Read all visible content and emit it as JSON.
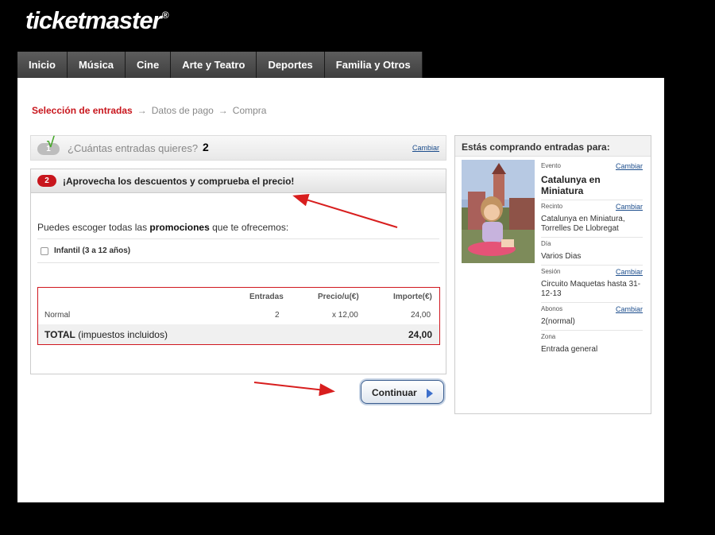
{
  "brand": {
    "logo_text": "ticketmaster",
    "logo_mark": "®"
  },
  "nav": {
    "items": [
      {
        "label": "Inicio"
      },
      {
        "label": "Música"
      },
      {
        "label": "Cine"
      },
      {
        "label": "Arte y Teatro"
      },
      {
        "label": "Deportes"
      },
      {
        "label": "Familia y Otros"
      }
    ]
  },
  "steps": {
    "step1": "Selección de entradas",
    "step2": "Datos de pago",
    "step3": "Compra",
    "arrow": "→"
  },
  "step_one": {
    "badge": "1",
    "check": "√",
    "question": "¿Cuántas entradas quieres?",
    "count": "2",
    "change_label": "Cambiar"
  },
  "step_two": {
    "badge": "2",
    "title": "¡Aprovecha los descuentos y comprueba el precio!",
    "promo_prefix": "Puedes escoger todas las ",
    "promo_bold": "promociones",
    "promo_suffix": " que te ofrecemos:",
    "option_label": "Infantil (3 a 12 años)"
  },
  "price_table": {
    "headers": {
      "entradas": "Entradas",
      "precio": "Precio/u(€)",
      "importe": "Importe(€)"
    },
    "row": {
      "type": "Normal",
      "entradas": "2",
      "precio": "x 12,00",
      "importe": "24,00"
    },
    "total": {
      "label_bold": "TOTAL",
      "label_rest": " (impuestos incluidos)",
      "importe": "24,00"
    }
  },
  "continue_button": {
    "label": "Continuar"
  },
  "sidebar": {
    "title": "Estás comprando entradas para:",
    "change_label": "Cambiar",
    "fields": {
      "evento": {
        "label": "Evento",
        "value": "Catalunya en Miniatura"
      },
      "recinto": {
        "label": "Recinto",
        "value": "Catalunya en Miniatura, Torrelles De Llobregat"
      },
      "dia": {
        "label": "Día",
        "value": "Varios Dias"
      },
      "sesion": {
        "label": "Sesión",
        "value": "Circuito Maquetas hasta 31-12-13"
      },
      "abonos": {
        "label": "Abonos",
        "value": "2(normal)"
      },
      "zona": {
        "label": "Zona",
        "value": "Entrada general"
      }
    }
  },
  "colors": {
    "accent_red": "#c8161d",
    "check_green": "#46a82a",
    "link_blue": "#1c4d8c"
  }
}
